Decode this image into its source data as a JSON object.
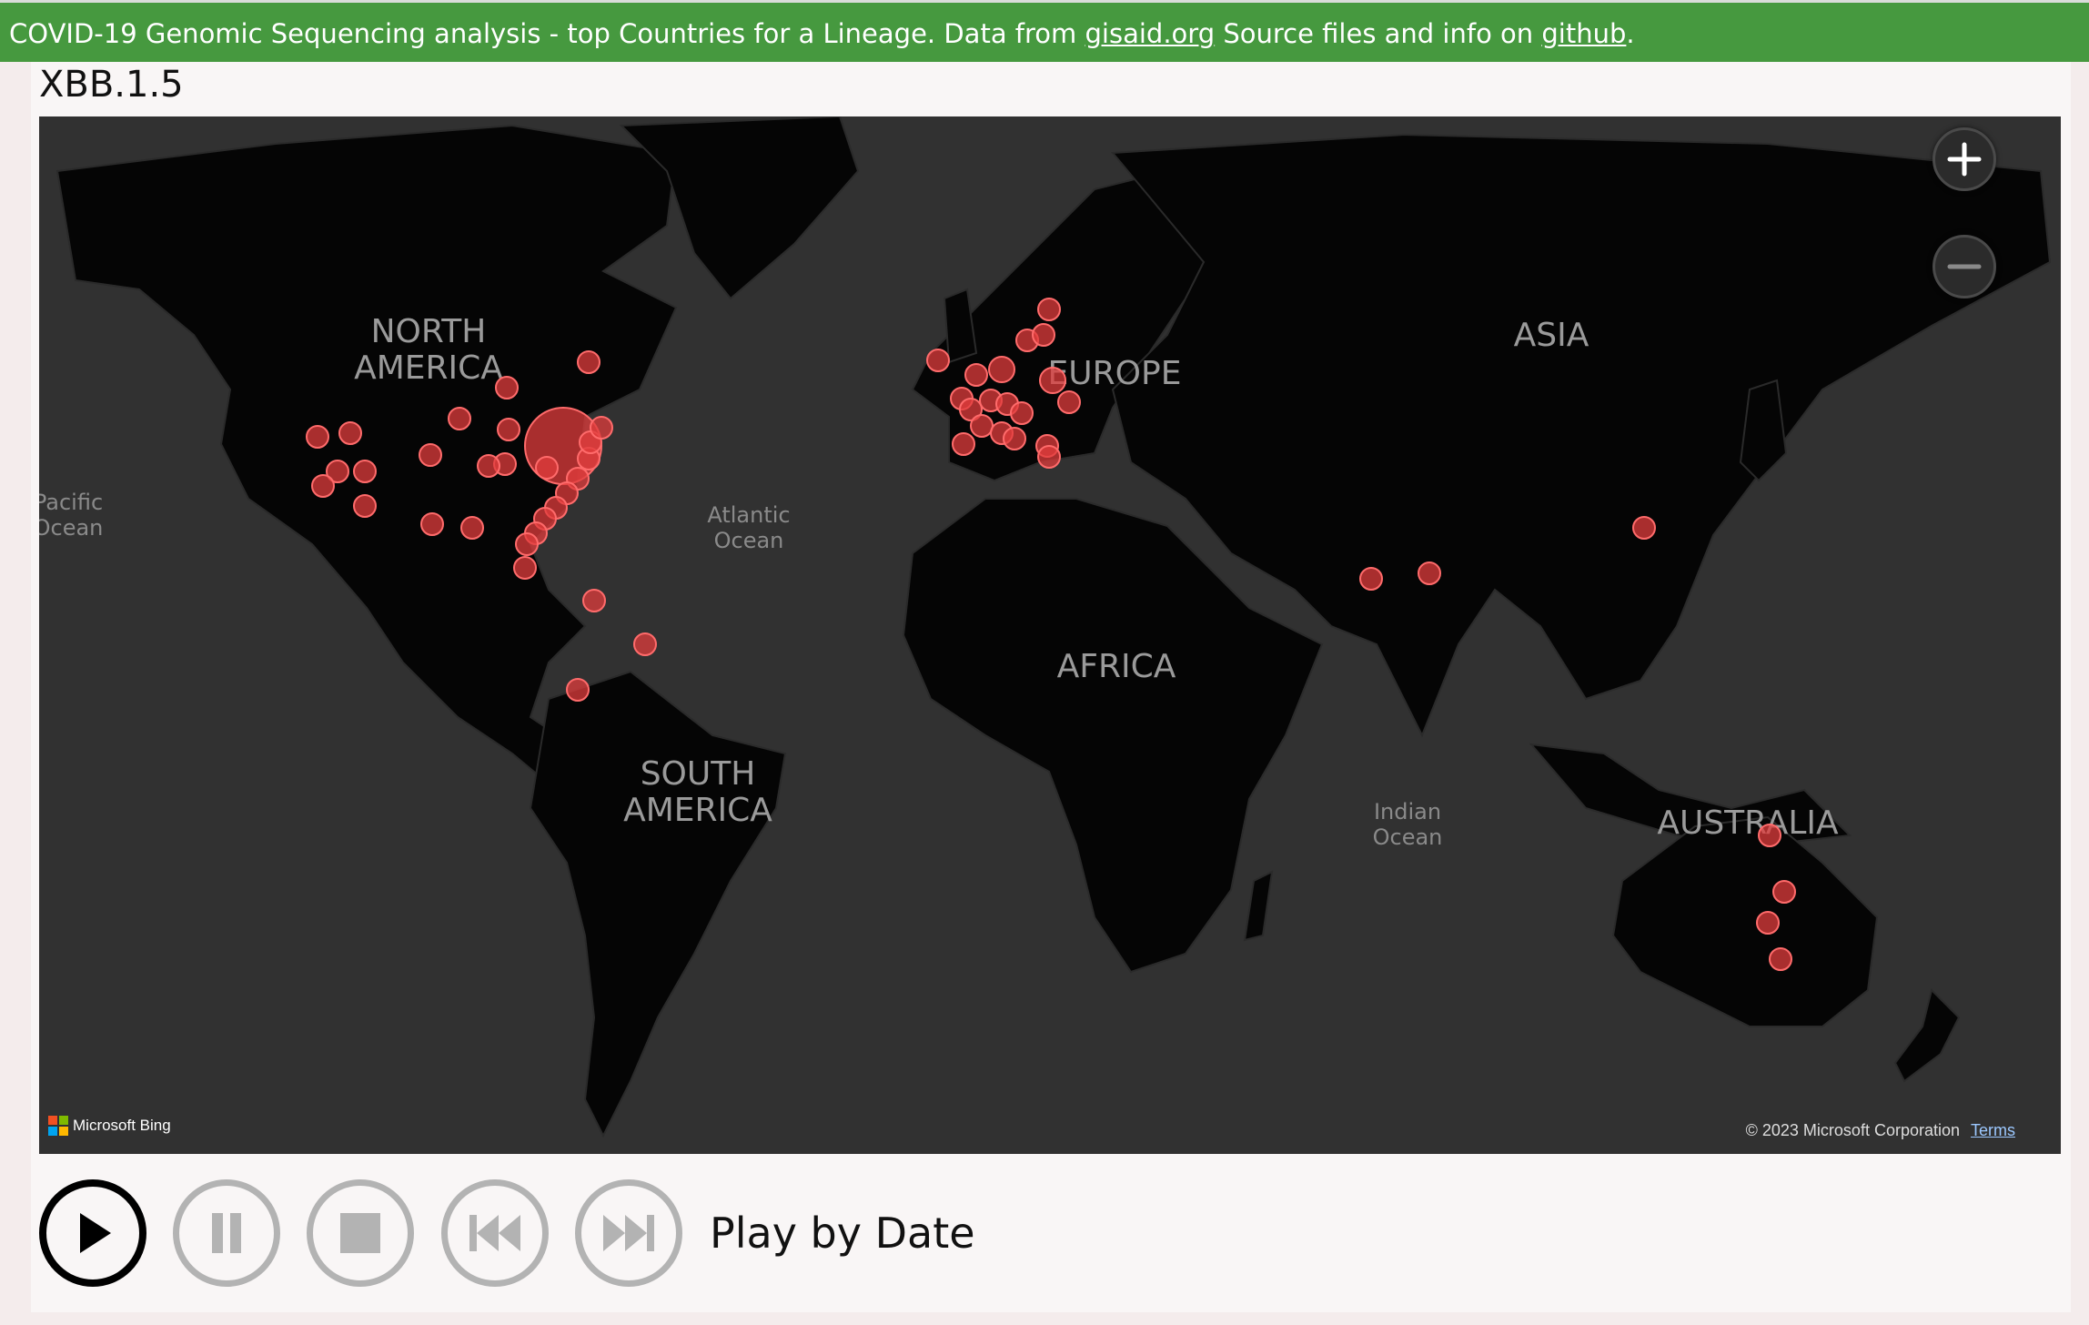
{
  "header": {
    "prefix": "COVID-19 Genomic Sequencing analysis - top Countries for a Lineage. Data from ",
    "link1": "gisaid.org",
    "middle": " Source files and info on ",
    "link2": "github",
    "suffix": "."
  },
  "lineage": "XBB.1.5",
  "map": {
    "continents": {
      "north_america": [
        "NORTH",
        "AMERICA"
      ],
      "south_america": [
        "SOUTH",
        "AMERICA"
      ],
      "europe": "EUROPE",
      "africa": "AFRICA",
      "asia": "ASIA",
      "australia": "AUSTRALIA"
    },
    "oceans": {
      "pacific": [
        "Pacific",
        "Ocean"
      ],
      "atlantic": [
        "Atlantic",
        "Ocean"
      ],
      "indian": [
        "Indian",
        "Ocean"
      ]
    },
    "attribution": "Microsoft Bing",
    "copyright": "© 2023 Microsoft Corporation",
    "terms": "Terms",
    "bubble_color": "#e03c3c",
    "land_color": "#050505",
    "water_color": "#313131"
  },
  "zoom": {
    "in_icon": "plus-icon",
    "out_icon": "minus-icon"
  },
  "controls": {
    "play_icon": "play-icon",
    "pause_icon": "pause-icon",
    "stop_icon": "stop-icon",
    "prev_icon": "skip-back-icon",
    "next_icon": "skip-forward-icon",
    "label": "Play by Date"
  }
}
